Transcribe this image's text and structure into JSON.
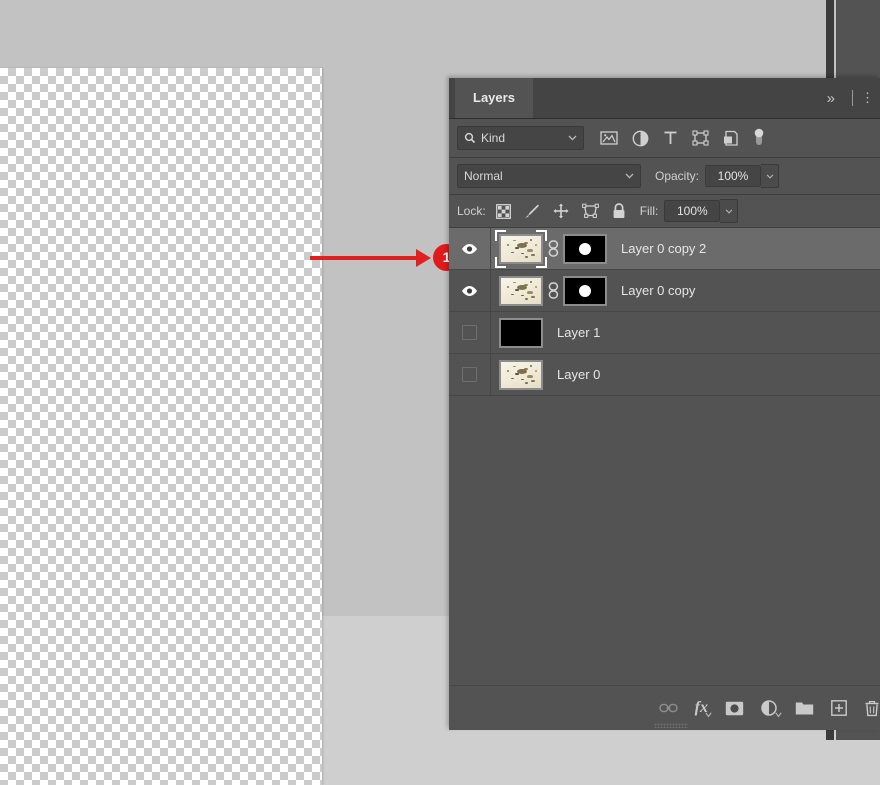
{
  "panel": {
    "tab_label": "Layers",
    "expand_icon": "chevron-double-right-icon",
    "menu_icon": "panel-menu-icon"
  },
  "filter": {
    "search_icon": "search-icon",
    "kind_value": "Kind",
    "dropdown_icon": "chevron-down-icon",
    "icons": [
      {
        "name": "filter-pixel-icon",
        "title": "Filter for pixel layers"
      },
      {
        "name": "filter-adjustment-icon",
        "title": "Filter for adjustment layers"
      },
      {
        "name": "filter-type-icon",
        "title": "Filter for type layers"
      },
      {
        "name": "filter-shape-icon",
        "title": "Filter for shape layers"
      },
      {
        "name": "filter-smart-object-icon",
        "title": "Filter for smart objects"
      }
    ],
    "toggle_icon": "filter-toggle-switch"
  },
  "blend": {
    "mode_value": "Normal",
    "opacity_label": "Opacity:",
    "opacity_value": "100%",
    "dropdown_icon": "chevron-down-icon"
  },
  "lock": {
    "label": "Lock:",
    "icons": [
      {
        "name": "lock-transparency-icon",
        "title": "Lock transparent pixels"
      },
      {
        "name": "lock-pixels-icon",
        "title": "Lock image pixels"
      },
      {
        "name": "lock-position-icon",
        "title": "Lock position"
      },
      {
        "name": "lock-artboard-icon",
        "title": "Prevent auto-nesting"
      },
      {
        "name": "lock-all-icon",
        "title": "Lock all"
      }
    ],
    "fill_label": "Fill:",
    "fill_value": "100%"
  },
  "layers": [
    {
      "name": "Layer 0 copy 2",
      "visible": true,
      "selected": true,
      "has_mask": true,
      "linked": true,
      "thumb_type": "photo"
    },
    {
      "name": "Layer 0 copy",
      "visible": true,
      "selected": false,
      "has_mask": true,
      "linked": true,
      "thumb_type": "photo"
    },
    {
      "name": "Layer 1",
      "visible": false,
      "selected": false,
      "has_mask": false,
      "linked": false,
      "thumb_type": "black"
    },
    {
      "name": "Layer 0",
      "visible": false,
      "selected": false,
      "has_mask": false,
      "linked": false,
      "thumb_type": "photo"
    }
  ],
  "footer": {
    "buttons": [
      {
        "name": "link-layers-button",
        "title": "Link layers"
      },
      {
        "name": "layer-style-button",
        "title": "Add a layer style"
      },
      {
        "name": "add-layer-mask-button",
        "title": "Add layer mask"
      },
      {
        "name": "new-adjustment-layer-button",
        "title": "Create new fill or adjustment layer"
      },
      {
        "name": "new-group-button",
        "title": "Create a new group"
      },
      {
        "name": "new-layer-button",
        "title": "Create a new layer"
      },
      {
        "name": "delete-layer-button",
        "title": "Delete layer"
      }
    ],
    "fx_label": "fx"
  },
  "annotation": {
    "badge_number": "1",
    "color": "#e01b1b"
  },
  "colors": {
    "panel_bg": "#535353",
    "tabbar_bg": "#444444",
    "row_selected": "#6b6b6b",
    "field_bg": "#454545",
    "text": "#e6e6e6",
    "workspace": "#c2c2c2"
  }
}
